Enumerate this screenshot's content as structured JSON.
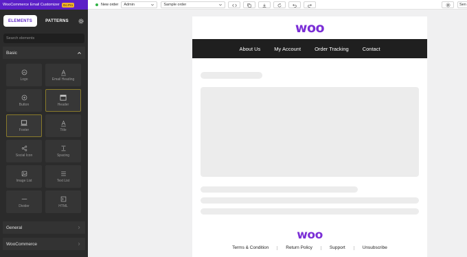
{
  "app": {
    "title": "WooCommerce Email Customizer",
    "badge": "Go Pro"
  },
  "sidebar": {
    "tabs": [
      {
        "label": "ELEMENTS",
        "active": true
      },
      {
        "label": "PATTERNS",
        "active": false
      }
    ],
    "search": {
      "placeholder": "Search elements",
      "value": ""
    },
    "sections": {
      "basic": {
        "label": "Basic",
        "expanded": true,
        "items": [
          {
            "label": "Logo",
            "icon": "logo-icon",
            "selected": false
          },
          {
            "label": "Email Heading",
            "icon": "heading-icon",
            "selected": false
          },
          {
            "label": "Button",
            "icon": "button-icon",
            "selected": false
          },
          {
            "label": "Header",
            "icon": "header-icon",
            "selected": true
          },
          {
            "label": "Footer",
            "icon": "footer-icon",
            "selected": true
          },
          {
            "label": "Title",
            "icon": "title-icon",
            "selected": false
          },
          {
            "label": "Social Icon",
            "icon": "share-icon",
            "selected": false
          },
          {
            "label": "Spacing",
            "icon": "spacing-icon",
            "selected": false
          },
          {
            "label": "Image List",
            "icon": "image-list-icon",
            "selected": false
          },
          {
            "label": "Text List",
            "icon": "text-list-icon",
            "selected": false
          },
          {
            "label": "Divider",
            "icon": "divider-icon",
            "selected": false
          },
          {
            "label": "HTML",
            "icon": "html-icon",
            "selected": false
          }
        ]
      },
      "general": {
        "label": "General",
        "expanded": false
      },
      "woocommerce": {
        "label": "WooCommerce",
        "expanded": false
      }
    }
  },
  "toolbar": {
    "order_type": "New order",
    "role_select": "Admin",
    "order_select": "Sample order",
    "buttons": [
      "code-icon",
      "copy-icon",
      "download-icon",
      "refresh-icon",
      "undo-icon",
      "redo-icon"
    ],
    "send_label": "Sen"
  },
  "email": {
    "logo_text": "woo",
    "nav": [
      "About Us",
      "My Account",
      "Order Tracking",
      "Contact"
    ],
    "footer_logo_text": "woo",
    "footer_links": [
      "Terms & Condition",
      "Return Policy",
      "Support",
      "Unsubscribe"
    ]
  },
  "colors": {
    "brand": "#5b1fc7",
    "woo_purple": "#7b2fd6",
    "sidebar_bg": "#2b2b2b",
    "nav_bg": "#1f1f1f",
    "status": "#2fb344",
    "pro_badge": "#f0b429"
  }
}
